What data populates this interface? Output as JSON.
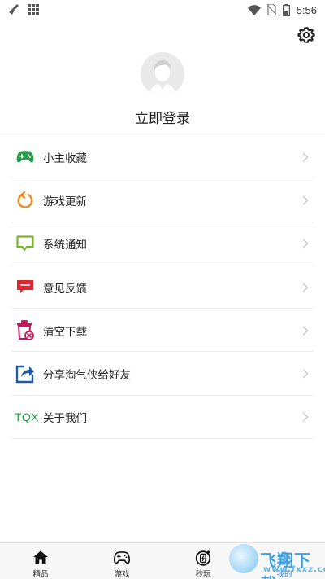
{
  "status_bar": {
    "time": "5:56",
    "left_icons": [
      "broom-icon",
      "grid-icon"
    ],
    "right_icons": [
      "wifi-icon",
      "no-sim-icon",
      "battery-icon"
    ]
  },
  "header": {
    "settings_icon": "gear-icon"
  },
  "profile": {
    "avatar_icon": "default-user-avatar",
    "login_label": "立即登录"
  },
  "menu": {
    "items": [
      {
        "label": "小主收藏",
        "icon": "gamepad-icon",
        "color": "#22a04a"
      },
      {
        "label": "游戏更新",
        "icon": "refresh-icon",
        "color": "#f08a24"
      },
      {
        "label": "系统通知",
        "icon": "message-icon",
        "color": "#7ab62a"
      },
      {
        "label": "意见反馈",
        "icon": "chat-bubble-icon",
        "color": "#e0262d"
      },
      {
        "label": "清空下载",
        "icon": "trash-icon",
        "color": "#c2185b"
      },
      {
        "label": "分享淘气侠给好友",
        "icon": "share-icon",
        "color": "#1e5aa8"
      },
      {
        "label": "关于我们",
        "icon_text": "TQX",
        "color": "#22a04a"
      }
    ]
  },
  "bottom_nav": {
    "tabs": [
      {
        "label": "精品",
        "icon": "home-icon"
      },
      {
        "label": "游戏",
        "icon": "gamepad-icon"
      },
      {
        "label": "秒玩",
        "icon": "instant-play-icon"
      },
      {
        "label": "我的",
        "icon": "user-icon"
      }
    ]
  },
  "watermark": {
    "text": "飞翔下载",
    "sub": "www.fxxz.com"
  }
}
